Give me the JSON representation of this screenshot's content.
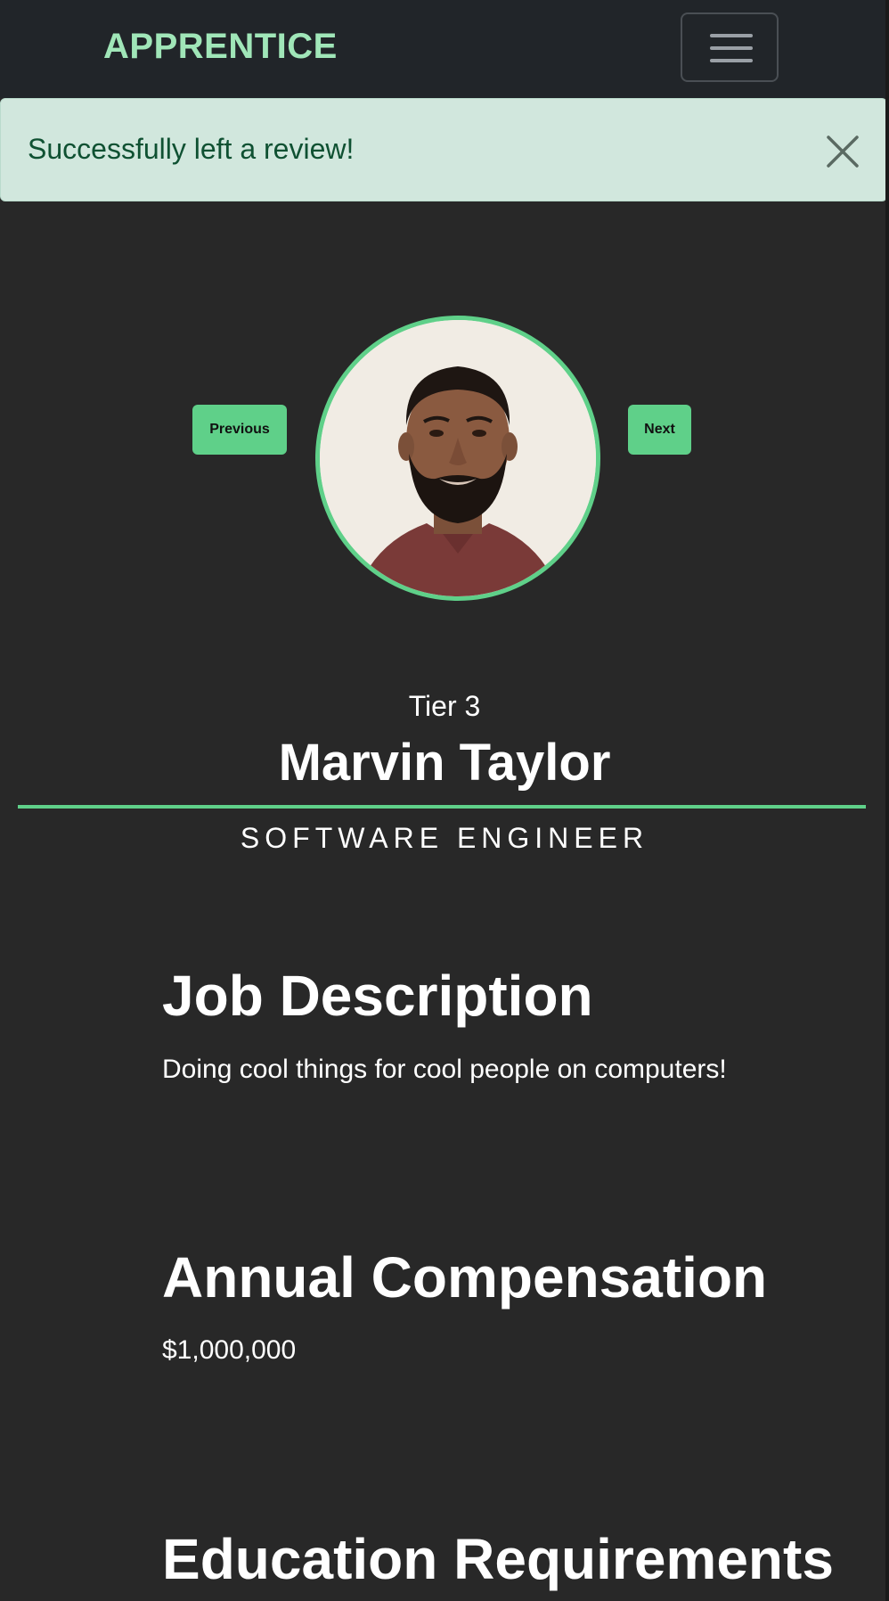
{
  "navbar": {
    "brand": "APPRENTICE",
    "menu_icon": "hamburger-icon"
  },
  "alert": {
    "message": "Successfully left a review!",
    "close_icon": "close-icon"
  },
  "carousel": {
    "previous_label": "Previous",
    "next_label": "Next"
  },
  "profile": {
    "tier": "Tier 3",
    "name": "Marvin Taylor",
    "job_title": "SOFTWARE ENGINEER"
  },
  "sections": {
    "job_description": {
      "heading": "Job Description",
      "text": "Doing cool things for cool people on computers!"
    },
    "annual_compensation": {
      "heading": "Annual Compensation",
      "text": "$1,000,000"
    },
    "education_requirements": {
      "heading": "Education Requirements"
    }
  },
  "colors": {
    "accent": "#5fd089",
    "brand": "#a0e6b8",
    "background": "#282828",
    "navbar": "#212529",
    "alert_bg": "#d1e7dd",
    "alert_text": "#0f5132"
  }
}
